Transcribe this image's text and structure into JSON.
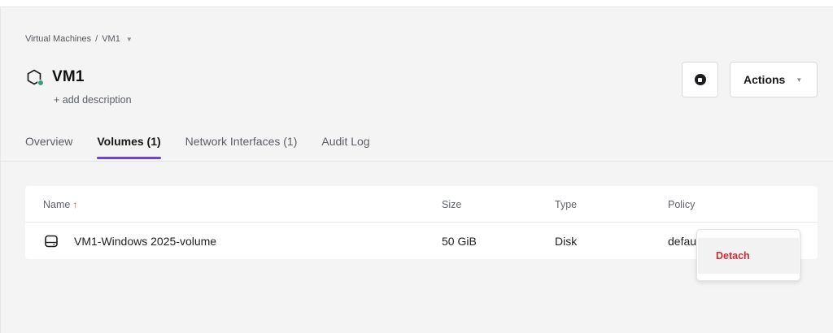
{
  "breadcrumb": {
    "parent": "Virtual Machines",
    "separator": "/",
    "current": "VM1"
  },
  "vm": {
    "name": "VM1",
    "add_description": "+ add description",
    "status_color": "#2fa37a"
  },
  "header_actions": {
    "stop_icon": "stop-icon",
    "actions_label": "Actions"
  },
  "tabs": [
    {
      "label": "Overview",
      "active": false
    },
    {
      "label": "Volumes (1)",
      "active": true
    },
    {
      "label": "Network Interfaces (1)",
      "active": false
    },
    {
      "label": "Audit Log",
      "active": false
    }
  ],
  "table": {
    "columns": [
      "Name",
      "Size",
      "Type",
      "Policy"
    ],
    "sort_indicator": "↑",
    "rows": [
      {
        "icon": "disk-icon",
        "name": "VM1-Windows 2025-volume",
        "size": "50 GiB",
        "type": "Disk",
        "policy": "defau"
      }
    ]
  },
  "context_menu": {
    "items": [
      "Detach"
    ],
    "danger_color": "#cc2d3b"
  },
  "accent_color": "#6b45d9"
}
